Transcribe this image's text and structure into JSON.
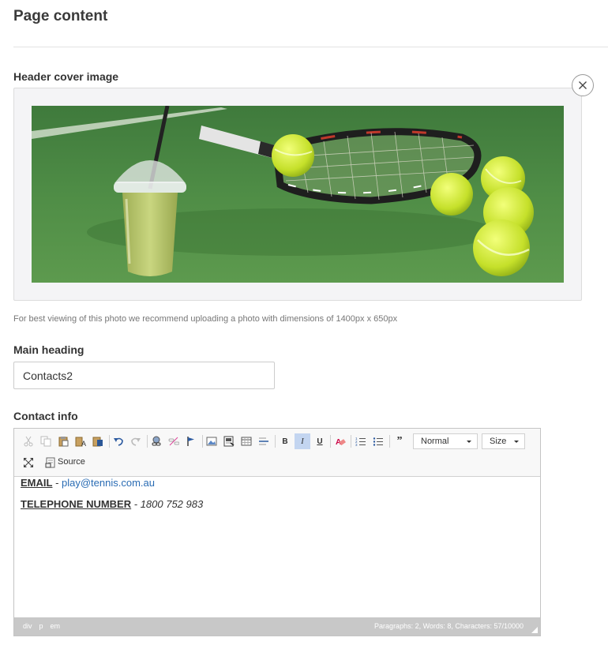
{
  "page": {
    "title": "Page content"
  },
  "cover": {
    "label": "Header cover image",
    "hint": "For best viewing of this photo we recommend uploading a photo with dimensions of 1400px x 650px",
    "close_icon": "close-icon"
  },
  "main_heading": {
    "label": "Main heading",
    "value": "Contacts2"
  },
  "contact_info": {
    "label": "Contact info",
    "toolbar": {
      "format_value": "Normal",
      "size_value": "Size",
      "source_label": "Source",
      "active_color": "#c3d5f0"
    },
    "content": {
      "email_label": "EMAIL",
      "email_sep": " - ",
      "email_value": "play@tennis.com.au",
      "phone_label": "TELEPHONE NUMBER",
      "phone_sep": " - ",
      "phone_value": "1800 752 983"
    },
    "status": {
      "path": [
        "div",
        "p",
        "em"
      ],
      "counts": "Paragraphs: 2, Words: 8, Characters: 57/10000"
    }
  }
}
